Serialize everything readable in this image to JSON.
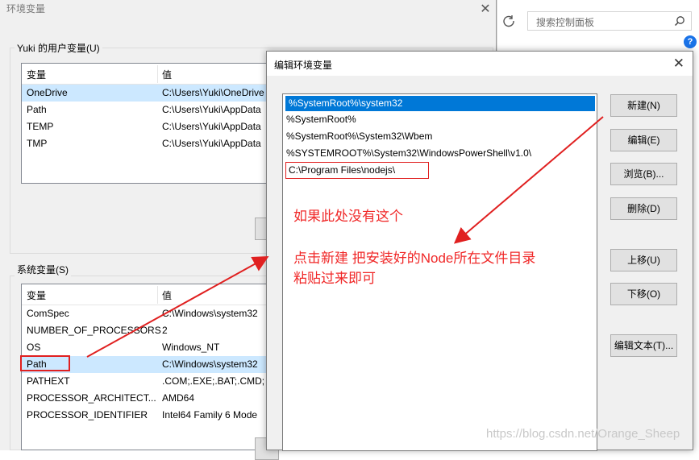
{
  "control_panel": {
    "search_placeholder": "搜索控制面板",
    "help_symbol": "?"
  },
  "env_dialog": {
    "title": "环境变量",
    "close_symbol": "✕",
    "user_group_label": "Yuki 的用户变量(U)",
    "system_group_label": "系统变量(S)",
    "columns": {
      "variable": "变量",
      "value": "值"
    },
    "user_vars": [
      {
        "name": "OneDrive",
        "value": "C:\\Users\\Yuki\\OneDrive"
      },
      {
        "name": "Path",
        "value": "C:\\Users\\Yuki\\AppData"
      },
      {
        "name": "TEMP",
        "value": "C:\\Users\\Yuki\\AppData"
      },
      {
        "name": "TMP",
        "value": "C:\\Users\\Yuki\\AppData"
      }
    ],
    "system_vars": [
      {
        "name": "ComSpec",
        "value": "C:\\Windows\\system32"
      },
      {
        "name": "NUMBER_OF_PROCESSORS",
        "value": "2"
      },
      {
        "name": "OS",
        "value": "Windows_NT"
      },
      {
        "name": "Path",
        "value": "C:\\Windows\\system32"
      },
      {
        "name": "PATHEXT",
        "value": ".COM;.EXE;.BAT;.CMD;"
      },
      {
        "name": "PROCESSOR_ARCHITECT...",
        "value": "AMD64"
      },
      {
        "name": "PROCESSOR_IDENTIFIER",
        "value": "Intel64 Family 6 Mode"
      }
    ]
  },
  "edit_dialog": {
    "title": "编辑环境变量",
    "close_symbol": "✕",
    "paths": [
      "%SystemRoot%\\system32",
      "%SystemRoot%",
      "%SystemRoot%\\System32\\Wbem",
      "%SYSTEMROOT%\\System32\\WindowsPowerShell\\v1.0\\",
      "C:\\Program Files\\nodejs\\"
    ],
    "buttons": {
      "new": "新建(N)",
      "edit": "编辑(E)",
      "browse": "浏览(B)...",
      "delete": "删除(D)",
      "move_up": "上移(U)",
      "move_down": "下移(O)",
      "edit_text": "编辑文本(T)..."
    }
  },
  "annotations": {
    "line1": "如果此处没有这个",
    "line2": "点击新建  把安装好的Node所在文件目录",
    "line3": "粘贴过来即可",
    "color": "#f02828"
  },
  "watermark": "https://blog.csdn.net/Orange_Sheep",
  "colors": {
    "selection": "#0078d7",
    "list_selection": "#cce8ff",
    "dialog_bg": "#f0f0f0"
  }
}
